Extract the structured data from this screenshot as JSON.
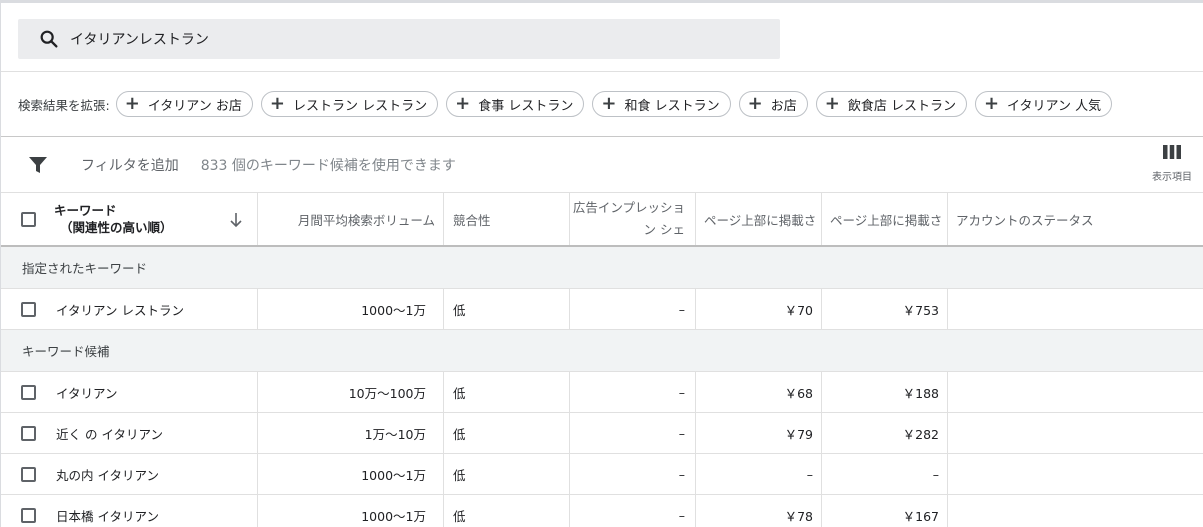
{
  "search": {
    "query": "イタリアンレストラン",
    "icon": "search-icon"
  },
  "expand": {
    "label": "検索結果を拡張:",
    "chips": [
      "イタリアン お店",
      "レストラン レストラン",
      "食事 レストラン",
      "和食 レストラン",
      "お店",
      "飲食店 レストラン",
      "イタリアン 人気"
    ]
  },
  "filter": {
    "add_label": "フィルタを追加",
    "hint": "833 個のキーワード候補を使用できます",
    "columns_label": "表示項目"
  },
  "table": {
    "headers": {
      "keyword_line1": "キーワード",
      "keyword_line2": "（関連性の高い順）",
      "volume": "月間平均検索ボリューム",
      "competition": "競合性",
      "impression": "広告インプレッション シェ",
      "bid_low": "ページ上部に掲載さ",
      "bid_high": "ページ上部に掲載さ",
      "account_status": "アカウントのステータス"
    },
    "group_provided": "指定されたキーワード",
    "provided_rows": [
      {
        "keyword": "イタリアン レストラン",
        "volume": "1000～1万",
        "competition": "低",
        "impression": "–",
        "bid_low": "￥70",
        "bid_high": "￥753"
      }
    ],
    "group_ideas": "キーワード候補",
    "idea_rows": [
      {
        "keyword": "イタリアン",
        "volume": "10万～100万",
        "competition": "低",
        "impression": "–",
        "bid_low": "￥68",
        "bid_high": "￥188"
      },
      {
        "keyword": "近く の イタリアン",
        "volume": "1万～10万",
        "competition": "低",
        "impression": "–",
        "bid_low": "￥79",
        "bid_high": "￥282"
      },
      {
        "keyword": "丸の内 イタリアン",
        "volume": "1000～1万",
        "competition": "低",
        "impression": "–",
        "bid_low": "–",
        "bid_high": "–"
      },
      {
        "keyword": "日本橋 イタリアン",
        "volume": "1000～1万",
        "competition": "低",
        "impression": "–",
        "bid_low": "￥78",
        "bid_high": "￥167"
      }
    ]
  }
}
